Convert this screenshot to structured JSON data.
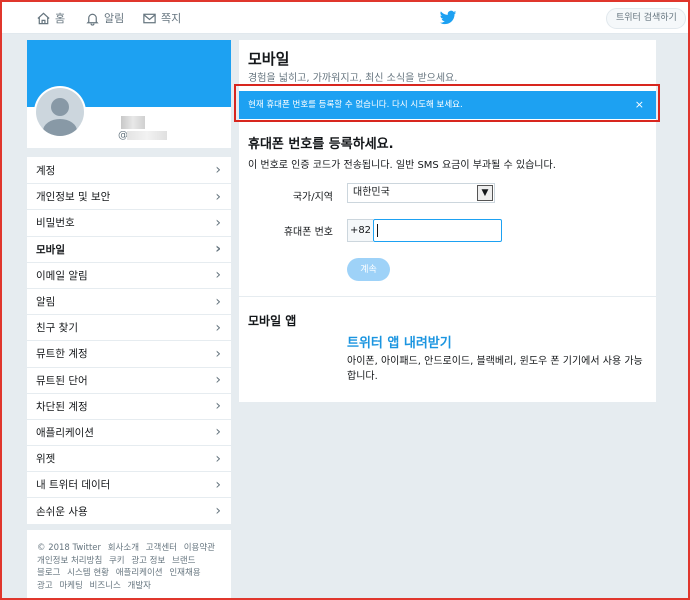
{
  "topnav": {
    "home_label": "홈",
    "notifications_label": "알림",
    "messages_label": "쪽지",
    "search_placeholder": "트위터 검색하기"
  },
  "profile": {
    "handle_prefix": "@"
  },
  "sidebar": {
    "items": [
      {
        "label": "계정"
      },
      {
        "label": "개인정보 및 보안"
      },
      {
        "label": "비밀번호"
      },
      {
        "label": "모바일"
      },
      {
        "label": "이메일 알림"
      },
      {
        "label": "알림"
      },
      {
        "label": "친구 찾기"
      },
      {
        "label": "뮤트한 계정"
      },
      {
        "label": "뮤트된 단어"
      },
      {
        "label": "차단된 계정"
      },
      {
        "label": "애플리케이션"
      },
      {
        "label": "위젯"
      },
      {
        "label": "내 트위터 데이터"
      },
      {
        "label": "손쉬운 사용"
      }
    ],
    "active_index": 3
  },
  "footer": {
    "links": [
      "© 2018 Twitter",
      "회사소개",
      "고객센터",
      "이용약관",
      "개인정보 처리방침",
      "쿠키",
      "광고 정보",
      "브랜드",
      "블로그",
      "시스템 현황",
      "애플리케이션",
      "인재채용",
      "광고",
      "마케팅",
      "비즈니스",
      "개발자"
    ]
  },
  "main": {
    "title": "모바일",
    "subtitle": "경험을 넓히고, 가까워지고, 최신 소식을 받으세요.",
    "alert_text": "현재 휴대폰 번호를 등록할 수 없습니다. 다시 시도해 보세요.",
    "alert_close": "×",
    "section_title": "휴대폰 번호를 등록하세요.",
    "section_desc": "이 번호로 인증 코드가 전송됩니다. 일반 SMS 요금이 부과될 수 있습니다.",
    "country_label": "국가/지역",
    "country_value": "대한민국",
    "phone_label": "휴대폰 번호",
    "phone_prefix": "+82",
    "phone_value": "",
    "continue_label": "계속",
    "app_section_title": "모바일 앱",
    "app_link": "트위터 앱 내려받기",
    "app_desc": "아이폰, 아이패드, 안드로이드, 블랙베리, 윈도우 폰 기기에서 사용 가능합니다."
  },
  "colors": {
    "brand_blue": "#1da1f2",
    "link_blue": "#1b95e0",
    "highlight_red": "#d8261e"
  }
}
